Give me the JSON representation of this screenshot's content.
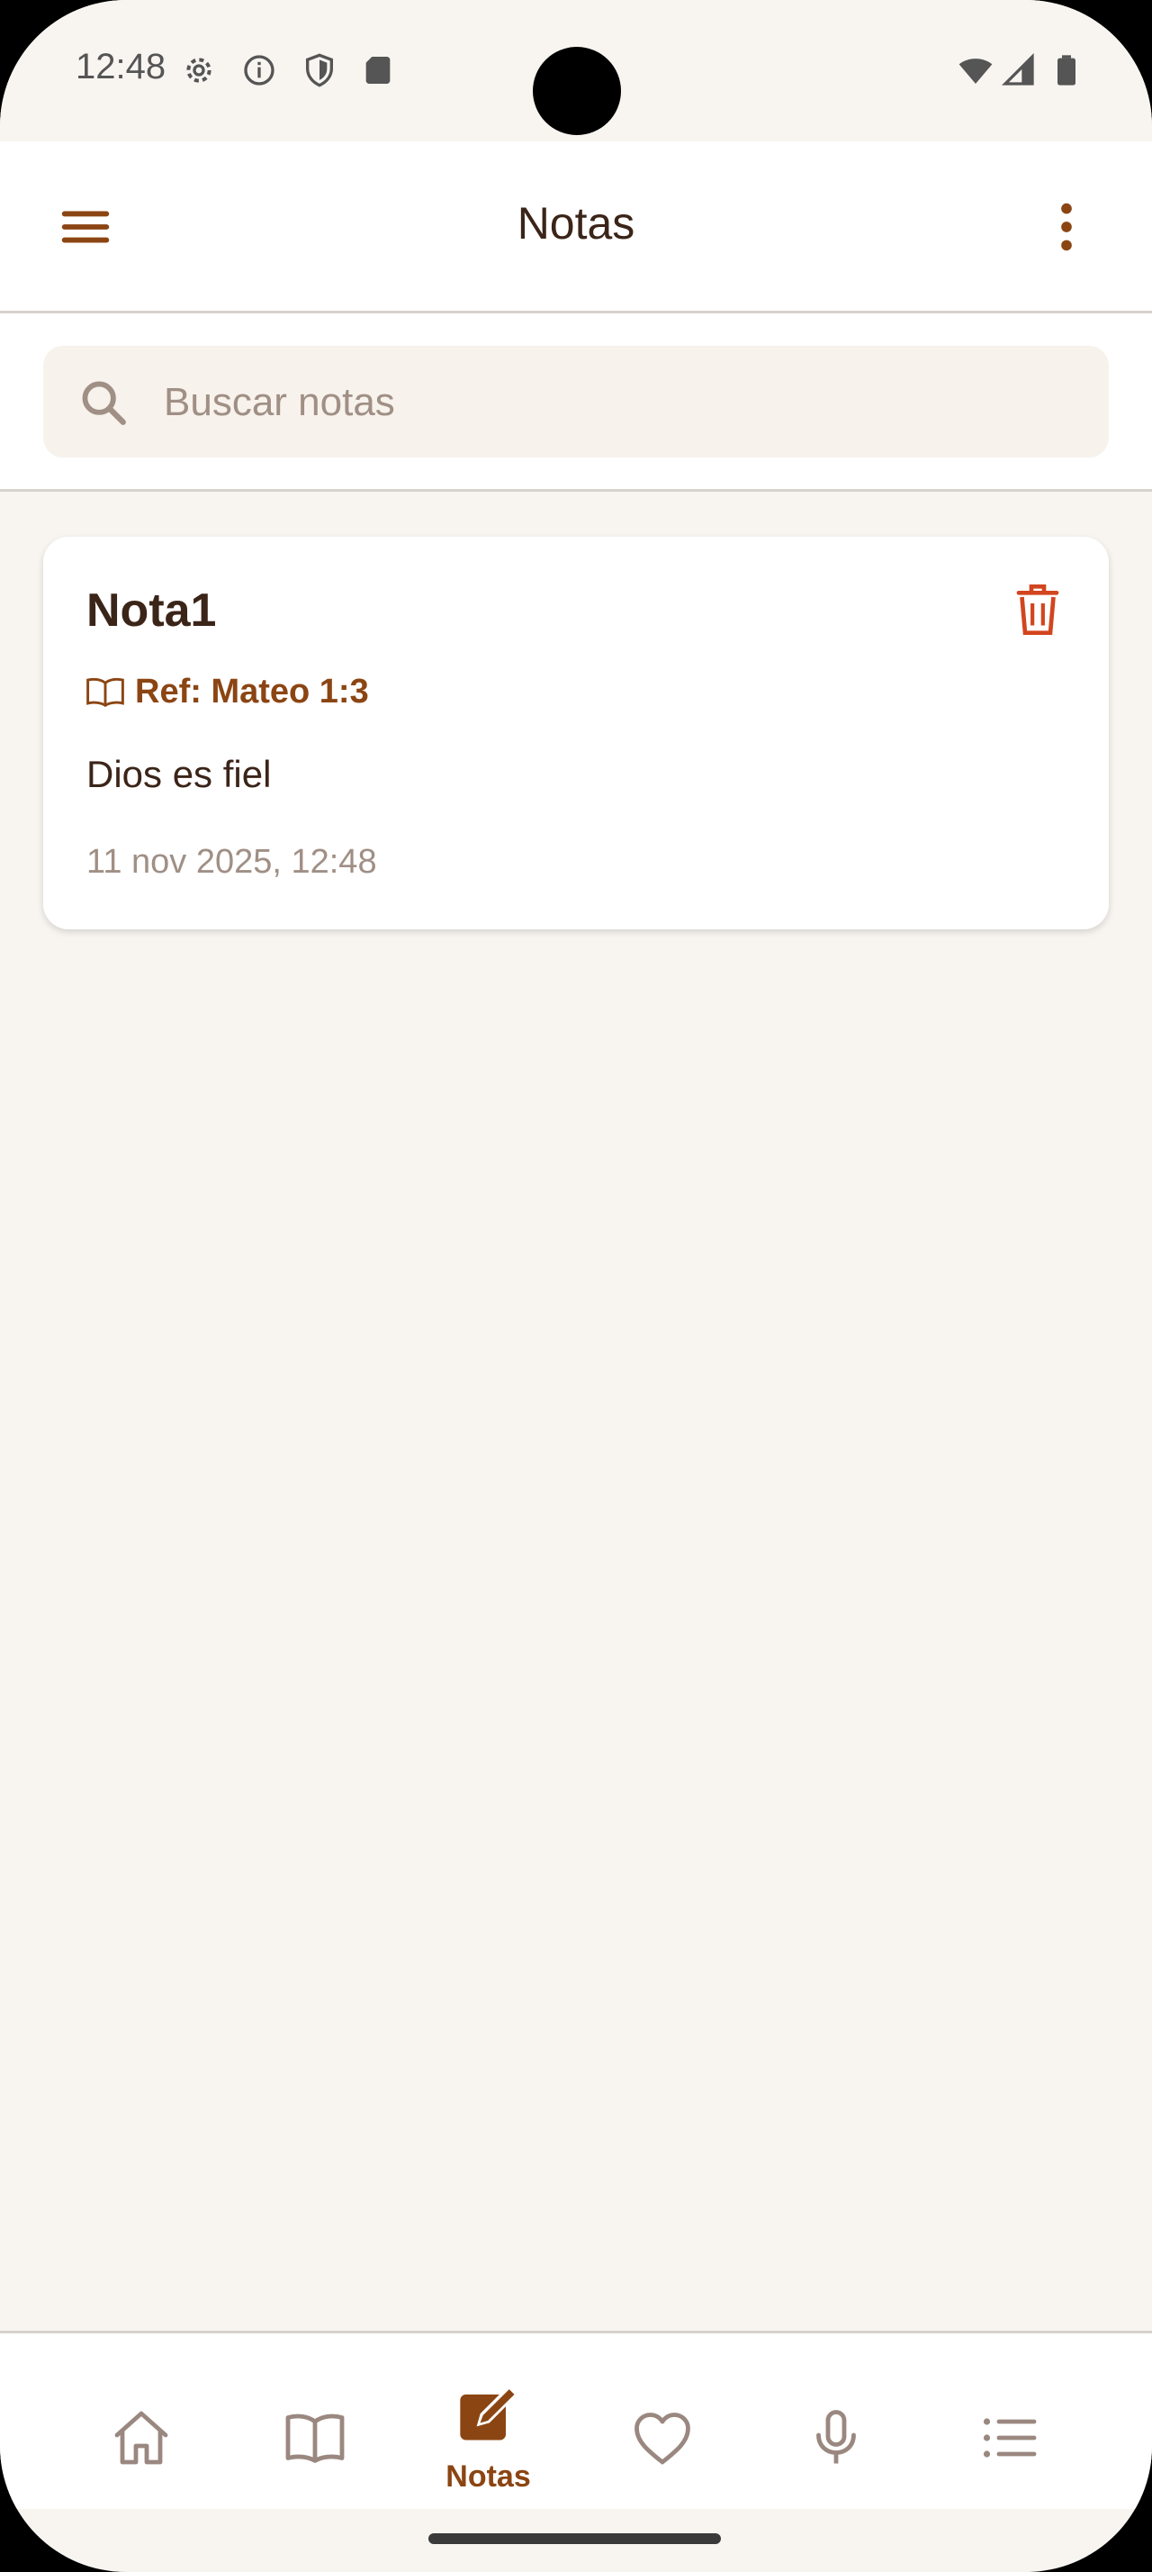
{
  "status_bar": {
    "time": "12:48",
    "left_icons": [
      "gear-icon",
      "info-icon",
      "shield-icon",
      "sd-card-icon"
    ],
    "right_icons": [
      "wifi-icon",
      "signal-icon",
      "battery-icon"
    ]
  },
  "app_bar": {
    "title": "Notas",
    "menu_icon": "hamburger-menu-icon",
    "more_icon": "more-vertical-icon"
  },
  "search": {
    "placeholder": "Buscar notas",
    "value": ""
  },
  "notes": [
    {
      "title": "Nota1",
      "reference": "Ref: Mateo 1:3",
      "body": "Dios es fiel",
      "date": "11 nov 2025, 12:48"
    }
  ],
  "bottom_nav": {
    "items": [
      {
        "icon": "home-icon",
        "label": "",
        "active": false
      },
      {
        "icon": "book-icon",
        "label": "",
        "active": false
      },
      {
        "icon": "edit-note-icon",
        "label": "Notas",
        "active": true
      },
      {
        "icon": "heart-icon",
        "label": "",
        "active": false
      },
      {
        "icon": "microphone-icon",
        "label": "",
        "active": false
      },
      {
        "icon": "list-icon",
        "label": "",
        "active": false
      }
    ]
  },
  "colors": {
    "accent": "#8b4513",
    "background": "#f8f5f1",
    "delete": "#d2451e",
    "text_primary": "#3b2418",
    "text_muted": "#a08f85"
  }
}
